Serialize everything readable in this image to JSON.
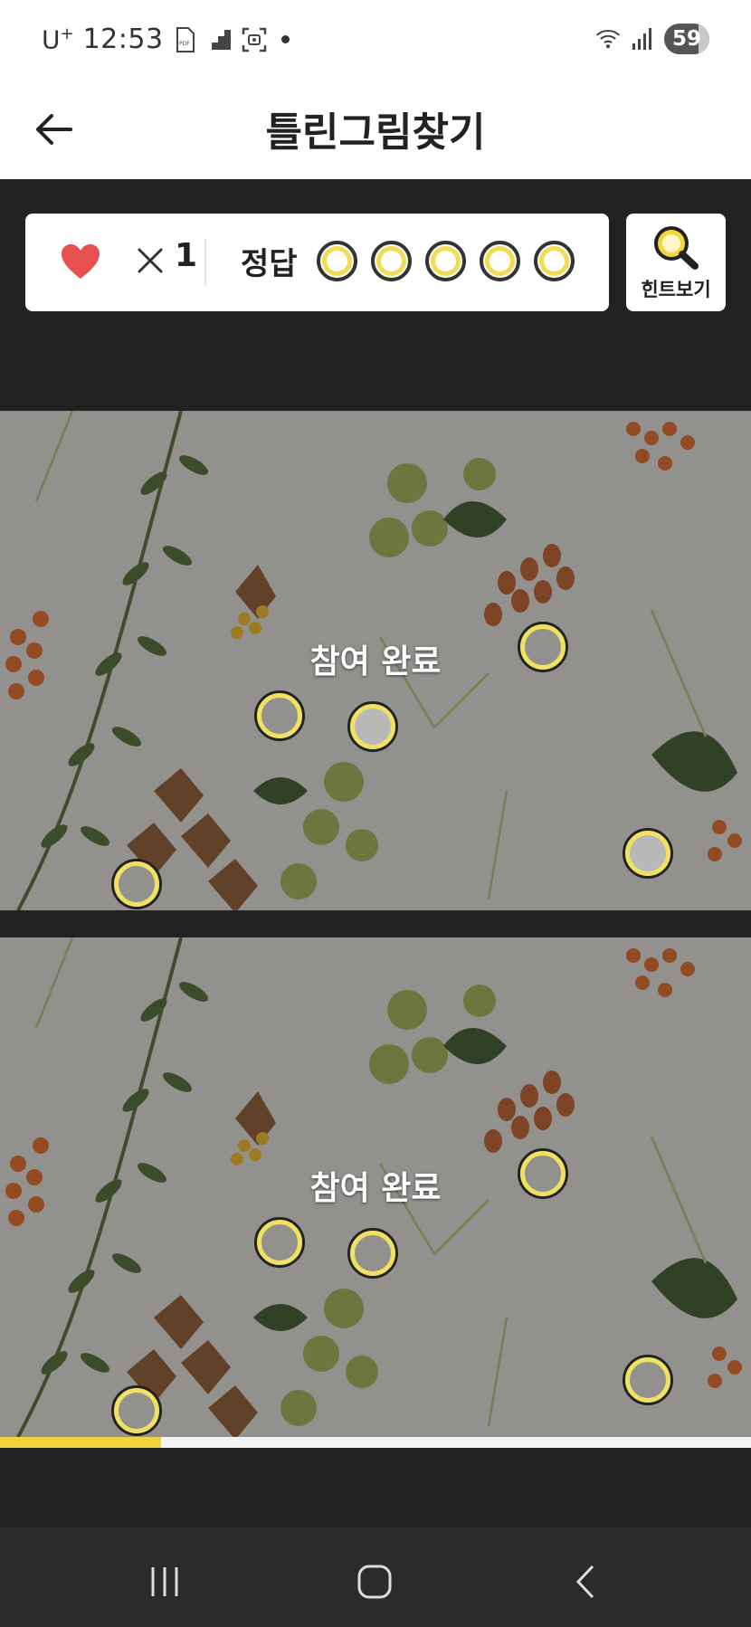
{
  "status_bar": {
    "carrier": "U",
    "carrier_sup": "+",
    "time": "12:53",
    "battery": "59"
  },
  "header": {
    "title": "틀린그림찾기",
    "back_icon": "arrow-left-icon"
  },
  "game_info": {
    "lives_symbol": "×",
    "lives": "1",
    "answer_label": "정답",
    "answers_total": 5,
    "answers_found": 0,
    "hint_label": "힌트보기",
    "heart_color": "#e84f4f",
    "accent_color": "#f0dc56"
  },
  "pictures": {
    "overlay_text": "참여 완료",
    "top": {
      "markers": 5
    },
    "bottom": {
      "markers": 5
    }
  },
  "progress": {
    "value": 0.215,
    "color": "#f0d23a"
  },
  "nav": {
    "recents_icon": "recents-icon",
    "home_icon": "home-icon",
    "back_icon": "back-icon"
  }
}
